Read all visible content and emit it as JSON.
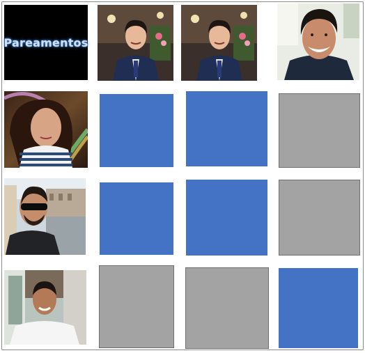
{
  "board": {
    "title_card": {
      "text": "Pareamentos"
    },
    "colors": {
      "face_down_blue": "#4472c4",
      "inactive_gray": "#a3a3a3",
      "title_bg": "#000000"
    },
    "grid": [
      [
        "title",
        "photo-suit-boy",
        "photo-suit-boy",
        "photo-smiling-man"
      ],
      [
        "photo-girl-rainbow",
        "blue",
        "blue",
        "gray"
      ],
      [
        "photo-man-sunglasses",
        "blue",
        "blue",
        "gray"
      ],
      [
        "photo-boy-white-shirt",
        "gray",
        "gray",
        "blue"
      ]
    ]
  }
}
